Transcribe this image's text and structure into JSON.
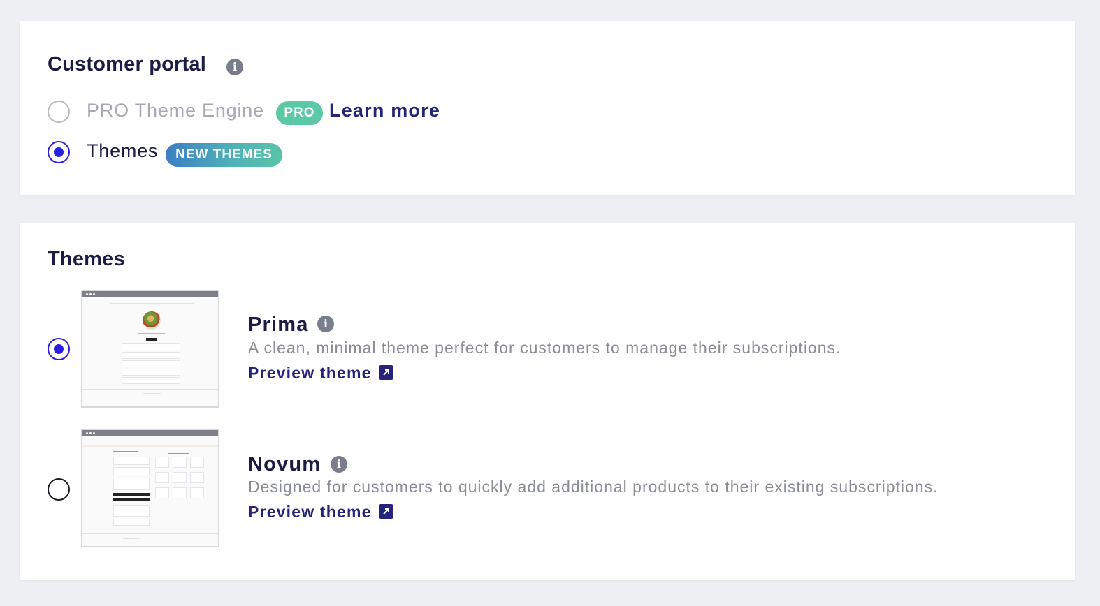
{
  "portal": {
    "title": "Customer portal",
    "options": [
      {
        "label": "PRO Theme Engine",
        "badge": "PRO",
        "link": "Learn more",
        "selected": false
      },
      {
        "label": "Themes",
        "badge": "NEW THEMES",
        "selected": true
      }
    ]
  },
  "themes": {
    "title": "Themes",
    "items": [
      {
        "name": "Prima",
        "description": "A clean, minimal theme perfect for customers to manage their subscriptions.",
        "preview_label": "Preview theme",
        "selected": true
      },
      {
        "name": "Novum",
        "description": "Designed for customers to quickly add additional products to their existing subscriptions.",
        "preview_label": "Preview theme",
        "selected": false
      }
    ]
  },
  "colors": {
    "accent": "#2a1ee6",
    "link": "#25247a",
    "pro_badge": "#5cc9a6",
    "background": "#eeeff2"
  },
  "icons": {
    "info": "info-icon",
    "external": "external-link-icon"
  }
}
